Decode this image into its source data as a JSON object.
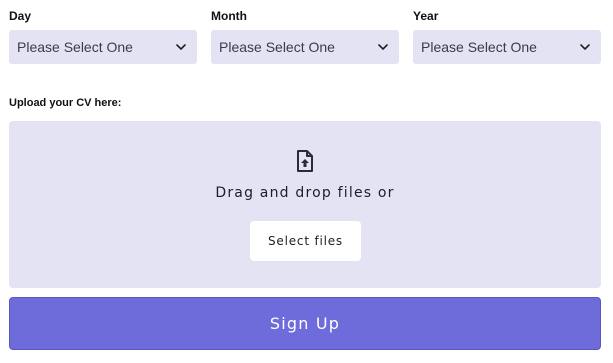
{
  "dob": {
    "day": {
      "label": "Day",
      "value": "Please Select One"
    },
    "month": {
      "label": "Month",
      "value": "Please Select One"
    },
    "year": {
      "label": "Year",
      "value": "Please Select One"
    }
  },
  "upload": {
    "label": "Upload your CV here:",
    "drop_text": "Drag and drop files or",
    "select_button": "Select files"
  },
  "submit": {
    "label": "Sign Up"
  },
  "colors": {
    "field_bg": "#e4e3f4",
    "primary": "#6e6bdb"
  },
  "icons": {
    "dropdown": "chevron-down-icon",
    "upload": "file-upload-icon"
  }
}
